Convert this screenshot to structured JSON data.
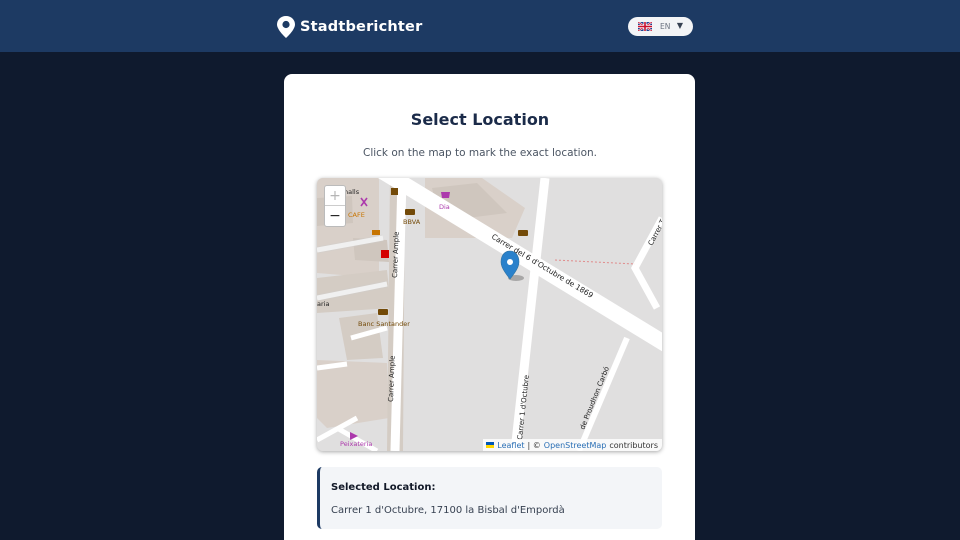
{
  "header": {
    "brand_name": "Stadtberichter",
    "logo_icon": "map-pin-icon",
    "language": {
      "code": "EN",
      "flag_icon": "uk-flag-icon",
      "dropdown_icon": "caret-down-icon"
    }
  },
  "main": {
    "title": "Select Location",
    "instructions": "Click on the map to mark the exact location."
  },
  "map": {
    "zoom_in_label": "+",
    "zoom_out_label": "−",
    "marker_icon": "location-marker-icon",
    "marker_color": "#2a81cb",
    "attribution": {
      "leaflet": "Leaflet",
      "separator": "| ©",
      "osm": "OpenStreetMap",
      "suffix": "contributors"
    },
    "street_labels": {
      "diagonal": "Carrer del 6 d'Octubre de 1869",
      "ample_top": "Carrer Ample",
      "ample_bottom": "Carrer Ample",
      "octubre": "Carrer 1 d'Octubre",
      "proudhon": "de Proudhon Carbó",
      "top_right": "Carrer T"
    },
    "poi_labels": {
      "dia": "Dia",
      "bbva": "BBVA",
      "cafe": "CAFE",
      "santander": "Banc Santander",
      "peixateria": "Peixateria",
      "halls": "halls",
      "aria": "aria"
    }
  },
  "selected_location": {
    "label": "Selected Location:",
    "address": "Carrer 1 d'Octubre, 17100 la Bisbal d'Empordà"
  },
  "colors": {
    "header_bg": "#1d3a63",
    "page_bg": "#0f1a2e",
    "title_color": "#1b2b49",
    "accent": "#1d3a63"
  }
}
